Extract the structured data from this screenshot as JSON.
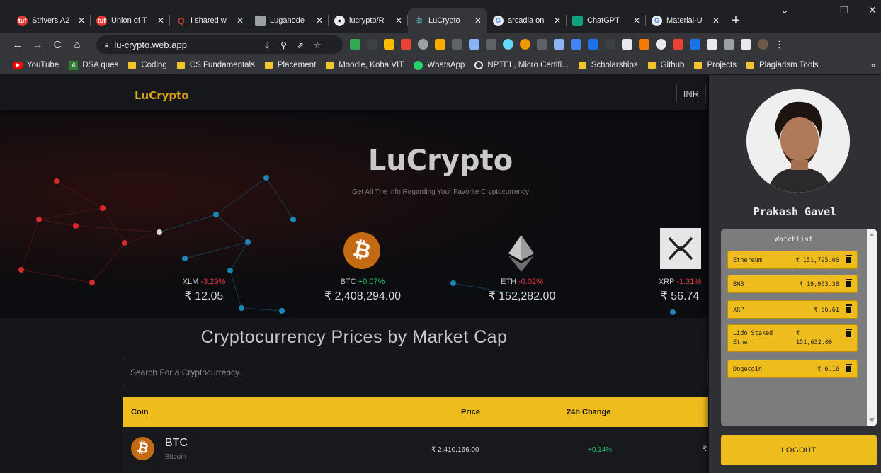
{
  "browser": {
    "tabs": [
      {
        "label": "Strivers A2",
        "favicon_color": "#e53935",
        "active": false
      },
      {
        "label": "Union of T",
        "favicon_color": "#e53935",
        "active": false
      },
      {
        "label": "I shared w",
        "favicon_color": "#e53935",
        "active": false
      },
      {
        "label": "Luganode",
        "favicon_color": "#9aa0a6",
        "active": false
      },
      {
        "label": "lucrypto/R",
        "favicon_color": "#e8eaed",
        "active": false
      },
      {
        "label": "LuCrypto",
        "favicon_color": "#61dafb",
        "active": true
      },
      {
        "label": "arcadia on",
        "favicon_color": "#4285f4",
        "active": false
      },
      {
        "label": "ChatGPT",
        "favicon_color": "#10a37f",
        "active": false
      },
      {
        "label": "Material-U",
        "favicon_color": "#4285f4",
        "active": false
      }
    ],
    "url": "lu-crypto.web.app",
    "bookmarks": [
      {
        "label": "YouTube",
        "icon": "youtube-icon"
      },
      {
        "label": "DSA ques",
        "icon": "dsa-icon"
      },
      {
        "label": "Coding",
        "icon": "folder-icon"
      },
      {
        "label": "CS Fundamentals",
        "icon": "folder-icon"
      },
      {
        "label": "Placement",
        "icon": "folder-icon"
      },
      {
        "label": "Moodle, Koha VIT",
        "icon": "folder-icon"
      },
      {
        "label": "WhatsApp",
        "icon": "whatsapp-icon"
      },
      {
        "label": "NPTEL, Micro Certifi...",
        "icon": "nptel-icon"
      },
      {
        "label": "Scholarships",
        "icon": "folder-icon"
      },
      {
        "label": "Github",
        "icon": "folder-icon"
      },
      {
        "label": "Projects",
        "icon": "folder-icon"
      },
      {
        "label": "Plagiarism Tools",
        "icon": "folder-icon"
      }
    ]
  },
  "app": {
    "brand": "LuCrypto",
    "currency": "INR",
    "hero": {
      "title": "LuCrypto",
      "subtitle": "Get All The Info Regarding Your Favorite Cryptocurrency"
    },
    "carousel": [
      {
        "symbol": "XLM",
        "change": "-3.29%",
        "price": "₹ 12.05"
      },
      {
        "symbol": "BTC",
        "change": "+0.07%",
        "price": "₹ 2,408,294.00"
      },
      {
        "symbol": "ETH",
        "change": "-0.02%",
        "price": "₹ 152,282.00"
      },
      {
        "symbol": "XRP",
        "change": "-1.31%",
        "price": "₹ 56.74"
      }
    ],
    "section_title": "Cryptocurrency Prices by Market Cap",
    "search_placeholder": "Search For a Cryptocurrency..",
    "table": {
      "headers": [
        "Coin",
        "Price",
        "24h Change"
      ],
      "rows": [
        {
          "symbol": "BTC",
          "name": "Bitcoin",
          "price": "₹ 2,410,166.00",
          "change": "+0.14%",
          "cut": "₹"
        }
      ]
    }
  },
  "drawer": {
    "user_name": "Prakash Gavel",
    "watchlist_title": "Watchlist",
    "watchlist": [
      {
        "name": "Ethereum",
        "price": "₹ 151,795.00"
      },
      {
        "name": "BNB",
        "price": "₹ 19,903.38"
      },
      {
        "name": "XRP",
        "price": "₹ 56.61"
      },
      {
        "name": "Lido Staked Ether",
        "name_line1": "Lido Staked",
        "name_line2": "Ether",
        "price_line1": "₹",
        "price_line2": "151,632.00"
      },
      {
        "name": "Dogecoin",
        "price": "₹ 6.16"
      }
    ],
    "logout_label": "LOGOUT"
  },
  "colors": {
    "accent": "#eebc1d",
    "positive": "#29c36a",
    "negative": "#e03a3a",
    "background": "#14161a"
  }
}
